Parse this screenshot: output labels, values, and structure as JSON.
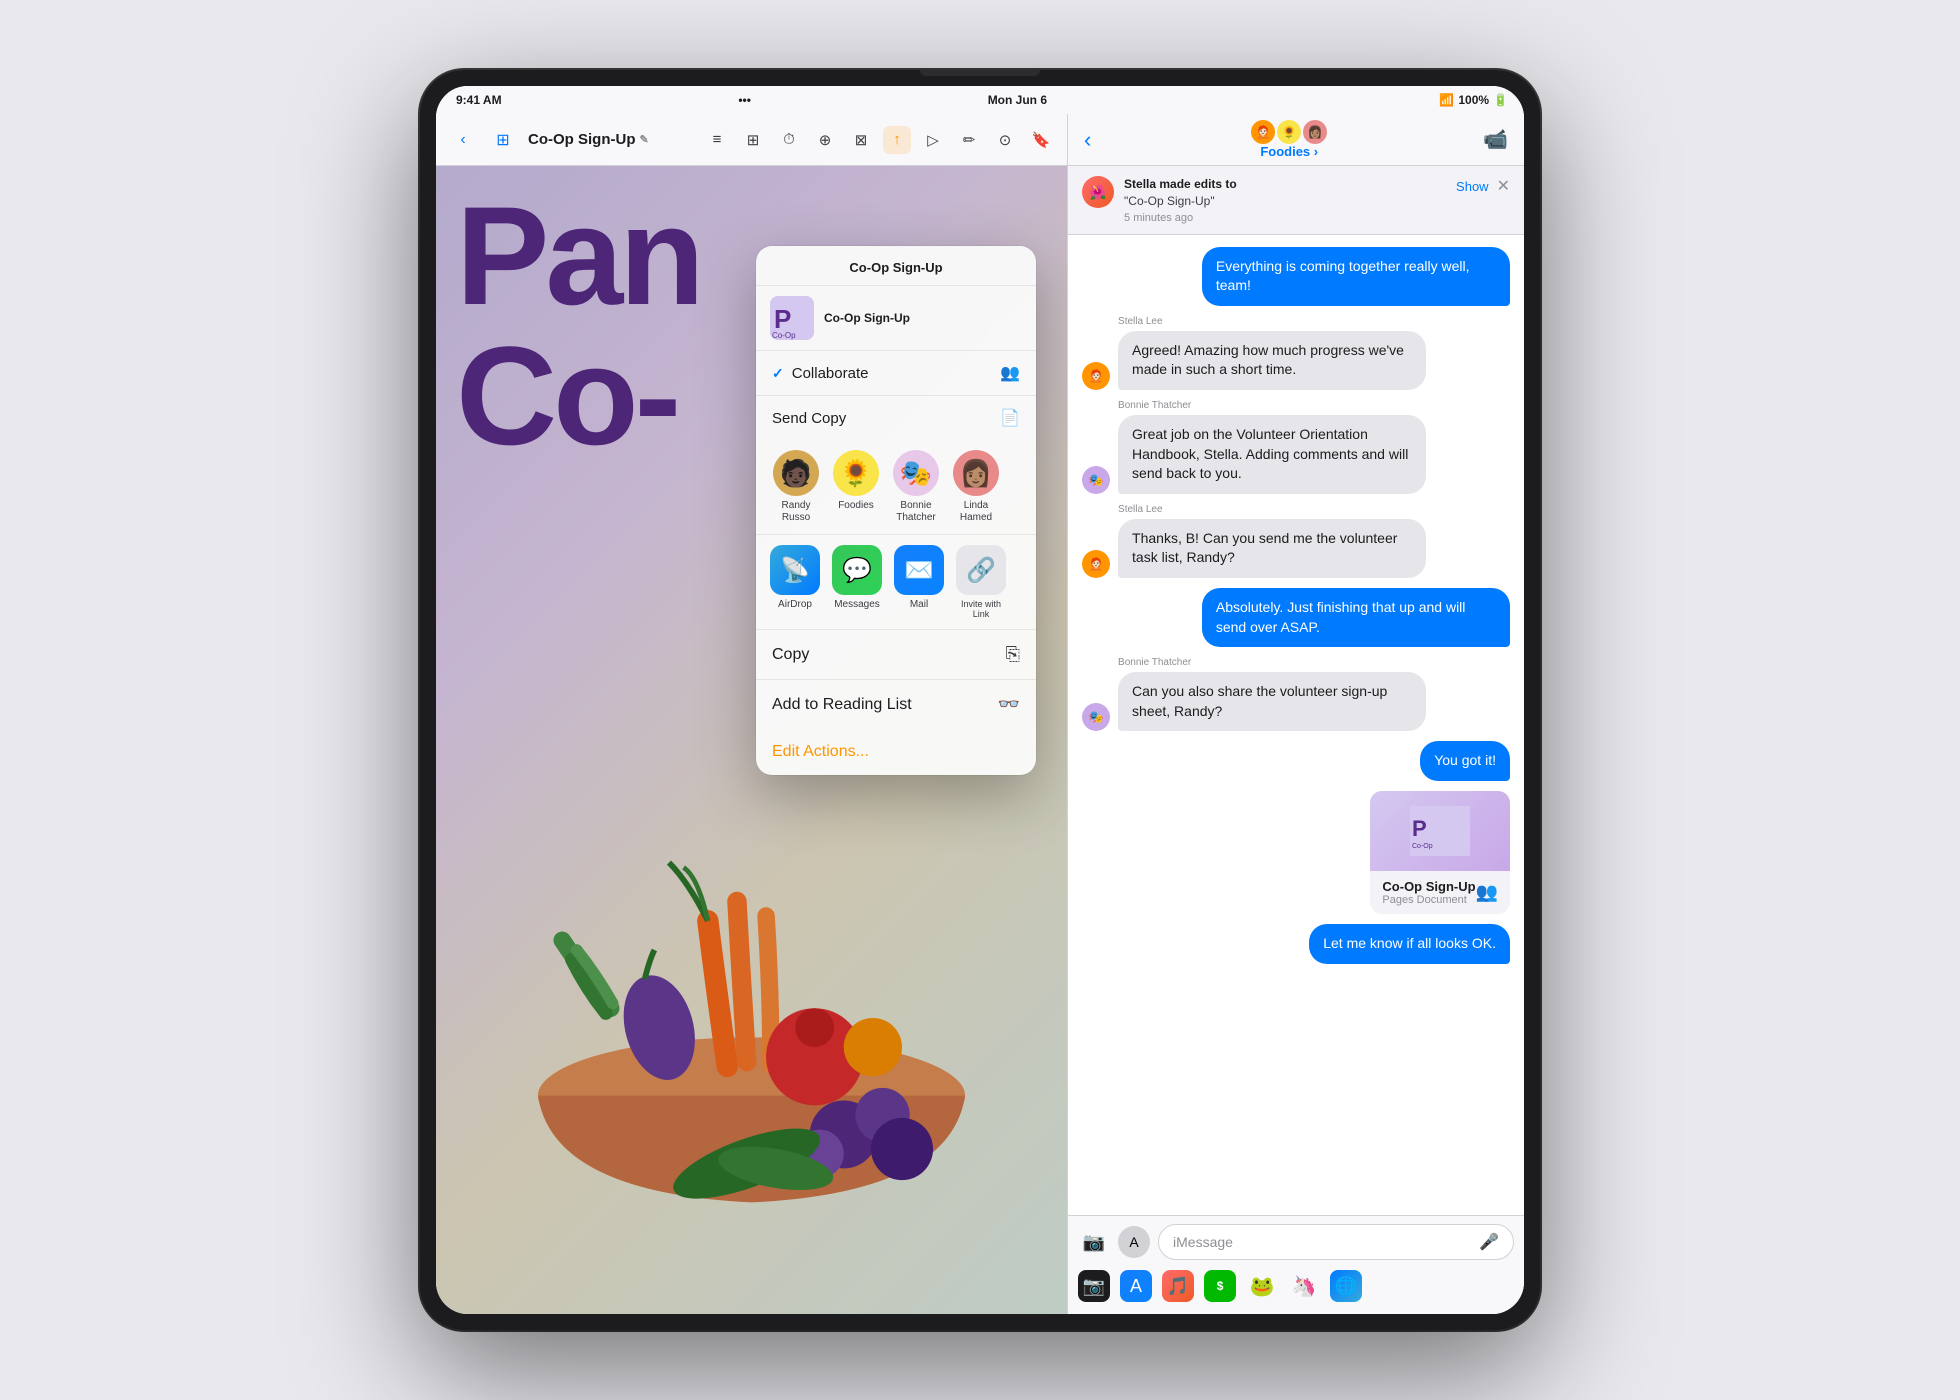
{
  "device": {
    "title": "iPad with Co-Op Sign-Up Pages and Messages"
  },
  "pages_status": {
    "time": "9:41 AM",
    "date": "Mon Jun 6"
  },
  "messages_status": {
    "wifi": "WiFi",
    "battery": "100%"
  },
  "pages_toolbar": {
    "back_label": "‹",
    "doc_title": "Co-Op Sign-Up",
    "edit_indicator": "✎",
    "icons": [
      "≡",
      "⊞",
      "⏱",
      "⊕",
      "⊠",
      "✿",
      "↑",
      "▷",
      "✏",
      "⊙",
      "🔖"
    ]
  },
  "document": {
    "large_text_line1": "Pan",
    "large_text_line2": "Co-"
  },
  "share_sheet": {
    "title": "Co-Op Sign-Up",
    "preview_title": "Co-Op Sign-Up",
    "collaborate_label": "Collaborate",
    "send_copy_label": "Send Copy",
    "people": [
      {
        "name": "Randy\nRusso",
        "avatar": "🧑🏿",
        "bg": "#d4a853"
      },
      {
        "name": "Foodies",
        "avatar": "🌻",
        "bg": "#f9e44a"
      },
      {
        "name": "Bonnie\nThatcher",
        "avatar": "🎭",
        "bg": "#e8c8e8"
      },
      {
        "name": "Linda\nHamed",
        "avatar": "👩🏽",
        "bg": "#e88a8a"
      }
    ],
    "apps": [
      {
        "name": "AirDrop",
        "icon": "📡"
      },
      {
        "name": "Messages",
        "icon": "💬"
      },
      {
        "name": "Mail",
        "icon": "✉️"
      },
      {
        "name": "Invite with\nLink",
        "icon": "🔗"
      }
    ],
    "actions": [
      {
        "label": "Copy",
        "icon": "⎘"
      },
      {
        "label": "Add to Reading List",
        "icon": "👓"
      }
    ],
    "edit_actions_label": "Edit Actions..."
  },
  "messages": {
    "group_name": "Foodies ›",
    "notification": {
      "text": "Stella made edits to",
      "doc_name": "\"Co-Op Sign-Up\"",
      "time": "5 minutes ago",
      "show_label": "Show"
    },
    "conversations": [
      {
        "type": "outgoing",
        "text": "Everything is coming together really well, team!",
        "bubble": "outgoing"
      },
      {
        "type": "incoming",
        "sender": "Stella Lee",
        "avatar": "🧑🏻‍🦰",
        "bg": "#ff9500",
        "text": "Agreed! Amazing how much progress we've made in such a short time.",
        "bubble": "incoming"
      },
      {
        "type": "incoming",
        "sender": "Bonnie Thatcher",
        "avatar": "🎭",
        "bg": "#c8a8e8",
        "text": "Great job on the Volunteer Orientation Handbook, Stella. Adding comments and will send back to you.",
        "bubble": "incoming"
      },
      {
        "type": "incoming",
        "sender": "Stella Lee",
        "avatar": "🧑🏻‍🦰",
        "bg": "#ff9500",
        "text": "Thanks, B! Can you send me the volunteer task list, Randy?",
        "bubble": "incoming"
      },
      {
        "type": "outgoing",
        "text": "Absolutely. Just finishing that up and will send over ASAP.",
        "bubble": "outgoing"
      },
      {
        "type": "incoming",
        "sender": "Bonnie Thatcher",
        "avatar": "🎭",
        "bg": "#c8a8e8",
        "text": "Can you also share the volunteer sign-up sheet, Randy?",
        "bubble": "incoming"
      },
      {
        "type": "outgoing",
        "text": "You got it!",
        "bubble": "outgoing"
      },
      {
        "type": "doc-attachment",
        "doc_name": "Co-Op Sign-Up",
        "doc_type": "Pages Document"
      },
      {
        "type": "outgoing",
        "text": "Let me know if all looks OK.",
        "bubble": "outgoing"
      }
    ],
    "input_placeholder": "iMessage"
  }
}
